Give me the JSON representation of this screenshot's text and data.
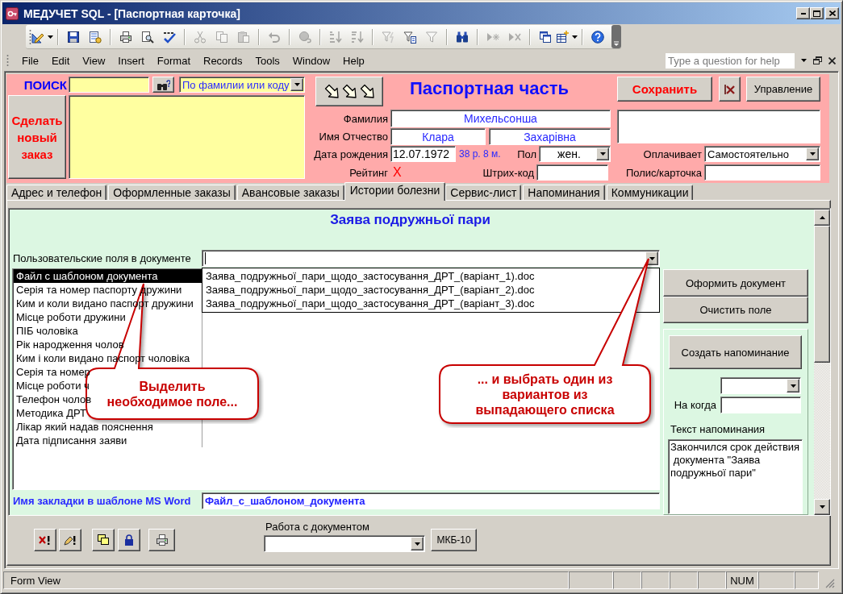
{
  "window": {
    "title": "МЕДУЧЕТ SQL - [Паспортная карточка]"
  },
  "toolbar_groups": [
    {
      "buttons": [
        {
          "disabled": false,
          "menu": true
        }
      ]
    },
    {
      "buttons": [
        {
          "disabled": false,
          "menu": false
        },
        {
          "disabled": false,
          "menu": false
        }
      ]
    },
    {
      "buttons": [
        {
          "disabled": false,
          "menu": false
        },
        {
          "disabled": false,
          "menu": false
        },
        {
          "disabled": false,
          "menu": false
        }
      ]
    },
    {
      "buttons": [
        {
          "disabled": true,
          "menu": false
        },
        {
          "disabled": true,
          "menu": false
        },
        {
          "disabled": true,
          "menu": false
        }
      ]
    },
    {
      "buttons": [
        {
          "disabled": true,
          "menu": false
        }
      ]
    },
    {
      "buttons": [
        {
          "disabled": true,
          "menu": false
        }
      ]
    },
    {
      "buttons": [
        {
          "disabled": true,
          "menu": false
        },
        {
          "disabled": true,
          "menu": false
        }
      ]
    },
    {
      "buttons": [
        {
          "disabled": true,
          "menu": false
        },
        {
          "disabled": false,
          "menu": false
        },
        {
          "disabled": true,
          "menu": false
        }
      ]
    },
    {
      "buttons": [
        {
          "disabled": false,
          "menu": false
        }
      ]
    },
    {
      "buttons": [
        {
          "disabled": true,
          "menu": false
        },
        {
          "disabled": true,
          "menu": false
        }
      ]
    },
    {
      "buttons": [
        {
          "disabled": false,
          "menu": false
        },
        {
          "disabled": false,
          "menu": true
        }
      ]
    },
    {
      "buttons": [
        {
          "disabled": false,
          "menu": false
        }
      ]
    }
  ],
  "menu": [
    "File",
    "Edit",
    "View",
    "Insert",
    "Format",
    "Records",
    "Tools",
    "Window",
    "Help"
  ],
  "help_box": {
    "placeholder": "Type a question for help"
  },
  "search": {
    "label": "ПОИСК",
    "mode": "По фамилии или коду"
  },
  "new_order_button": "Сделать новый заказ",
  "section_title": "Паспортная часть",
  "save_button": "Сохранить",
  "manage_button": "Управление",
  "patient": {
    "last_name": {
      "label": "Фамилия",
      "value": "Михельсонша"
    },
    "full_name": {
      "label": "Имя Отчество",
      "first_name": "Клара",
      "patronymic": "Захарівна"
    },
    "birth_date": {
      "label": "Дата рождения",
      "value": "12.07.1972",
      "age": "38 р. 8 м."
    },
    "sex": {
      "label": "Пол",
      "value": "жен."
    },
    "rating": {
      "label": "Рейтинг",
      "value": "X"
    },
    "barcode": {
      "label": "Штрих-код"
    },
    "payer": {
      "label": "Оплачивает",
      "value": "Самостоятельно"
    },
    "policy": {
      "label": "Полис/карточка"
    }
  },
  "tabs": [
    {
      "label": "Адрес и телефон",
      "selected": false
    },
    {
      "label": "Оформленные заказы",
      "selected": false
    },
    {
      "label": "Авансовые заказы",
      "selected": false
    },
    {
      "label": "Истории болезни",
      "selected": true
    },
    {
      "label": "Сервис-лист",
      "selected": false
    },
    {
      "label": "Напоминания",
      "selected": false
    },
    {
      "label": "Коммуникации",
      "selected": false
    }
  ],
  "document": {
    "title": "Заява подружньої пари",
    "fields_label": "Пользовательские поля в документе",
    "template_combo": {
      "expanded": true,
      "options": [
        "Заява_подружньої_пари_щодо_застосування_ДРТ_(варіант_1).doc",
        "Заява_подружньої_пари_щодо_застосування_ДРТ_(варіант_2).doc",
        "Заява_подружньої_пари_щодо_застосування_ДРТ_(варіант_3).doc"
      ]
    },
    "fields": [
      {
        "label": "Файл с шаблоном документа",
        "selected": true
      },
      {
        "label": "Серія та номер паспорту дружини",
        "selected": false
      },
      {
        "label": "Ким и коли видано паспорт дружини",
        "selected": false
      },
      {
        "label": "Місце роботи дружини",
        "selected": false
      },
      {
        "label": "ПІБ чоловіка",
        "selected": false
      },
      {
        "label": "Рік народження чолов",
        "selected": false
      },
      {
        "label": "Ким і коли видано паспорт чоловіка",
        "selected": false
      },
      {
        "label": "Серія та номер",
        "selected": false
      },
      {
        "label": "Місце роботи ч",
        "selected": false
      },
      {
        "label": "Телефон чолов",
        "selected": false
      },
      {
        "label": "Методика ДРТ",
        "selected": false
      },
      {
        "label": "Лікар який надав пояснення",
        "selected": false
      },
      {
        "label": "Дата підписання заяви",
        "selected": false
      }
    ],
    "bookmark": {
      "label": "Имя закладки в шаблоне MS Word",
      "value": "Файл_с_шаблоном_документа"
    },
    "actions": [
      "Оформить документ",
      "Очистить поле"
    ],
    "reminder": {
      "button": "Создать напоминание",
      "date_label": "На когда",
      "text_label": "Текст напоминания",
      "text": "Закончился срок действия\n документа \"Заява\nподружньої пари\""
    }
  },
  "footer": {
    "label": "Работа с документом",
    "icd_button": "МКБ-10"
  },
  "callouts": [
    {
      "text": "Выделить\nнеобходимое поле..."
    },
    {
      "text": "... и выбрать один из\nвариантов из\nвыпадающего списка"
    }
  ],
  "status_bar": {
    "text": "Form View",
    "indicators": [
      "NUM"
    ]
  }
}
